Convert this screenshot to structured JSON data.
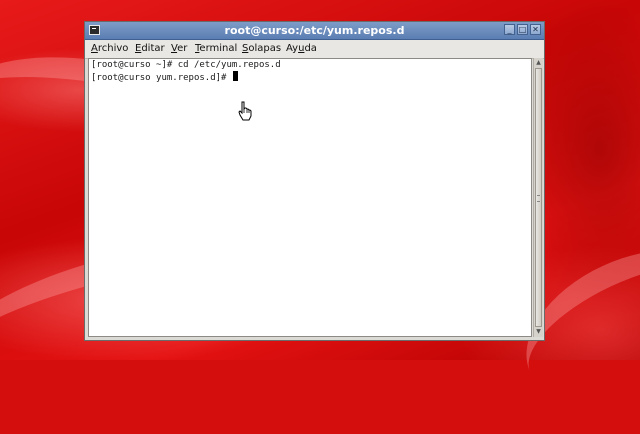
{
  "window": {
    "title": "root@curso:/etc/yum.repos.d"
  },
  "menubar": {
    "items": [
      {
        "label": "Archivo",
        "mnemonic": "A",
        "rest": "rchivo"
      },
      {
        "label": "Editar",
        "mnemonic": "E",
        "rest": "ditar"
      },
      {
        "label": "Ver",
        "mnemonic": "V",
        "rest": "er"
      },
      {
        "label": "Terminal",
        "mnemonic": "T",
        "rest": "erminal"
      },
      {
        "label": "Solapas",
        "mnemonic": "S",
        "rest": "olapas"
      },
      {
        "label": "Ayuda",
        "pre": "Ay",
        "mnemonic": "u",
        "rest": "da"
      }
    ]
  },
  "terminal": {
    "lines": [
      "[root@curso ~]# cd /etc/yum.repos.d",
      "[root@curso yum.repos.d]# "
    ]
  },
  "icons": {
    "app": "terminal-icon",
    "minimize": "minimize-icon",
    "maximize": "maximize-icon",
    "close": "close-icon",
    "pointer": "hand-cursor-icon"
  },
  "colors": {
    "desktop": "#d40d0d",
    "titlebar": "#6a8cc0",
    "terminal_bg": "#ffffff",
    "terminal_fg": "#1a1a1a"
  }
}
